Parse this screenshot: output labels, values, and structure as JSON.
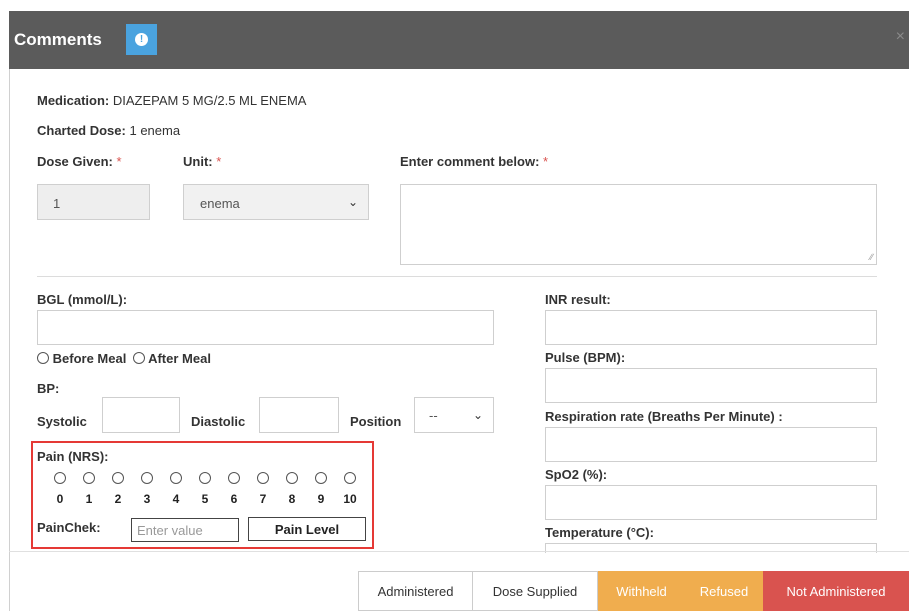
{
  "dialog": {
    "title": "Comments",
    "close": "×"
  },
  "medication": {
    "label": "Medication:",
    "value": "DIAZEPAM 5 MG/2.5 ML ENEMA"
  },
  "charted_dose": {
    "label": "Charted Dose:",
    "value": "1 enema"
  },
  "dose_given": {
    "label": "Dose Given:",
    "value": "1"
  },
  "unit": {
    "label": "Unit:",
    "value": "enema"
  },
  "comment": {
    "label": "Enter comment below:"
  },
  "required_mark": "*",
  "bgl": {
    "label": "BGL (mmol/L):",
    "before_meal": "Before Meal",
    "after_meal": "After Meal"
  },
  "bp": {
    "label": "BP:",
    "systolic": "Systolic",
    "diastolic": "Diastolic",
    "position": "Position",
    "position_value": "--"
  },
  "pain": {
    "label": "Pain (NRS):",
    "scale": [
      "0",
      "1",
      "2",
      "3",
      "4",
      "5",
      "6",
      "7",
      "8",
      "9",
      "10"
    ],
    "painchek_label": "PainChek:",
    "painchek_placeholder": "Enter value",
    "pain_level_button": "Pain Level"
  },
  "right_fields": {
    "inr": "INR result:",
    "pulse": "Pulse (BPM):",
    "respiration": "Respiration rate (Breaths Per Minute) :",
    "spo2": "SpO2 (%):",
    "temperature": "Temperature (°C):"
  },
  "footer": {
    "administered": "Administered",
    "dose_supplied": "Dose Supplied",
    "withheld": "Withheld",
    "refused": "Refused",
    "not_administered": "Not Administered"
  },
  "colors": {
    "header": "#5b5b5b",
    "info": "#4aa3df",
    "required": "#d9534f",
    "withheld": "#f0ad4e",
    "not_administered": "#d9534f",
    "highlight": "#e53935"
  }
}
